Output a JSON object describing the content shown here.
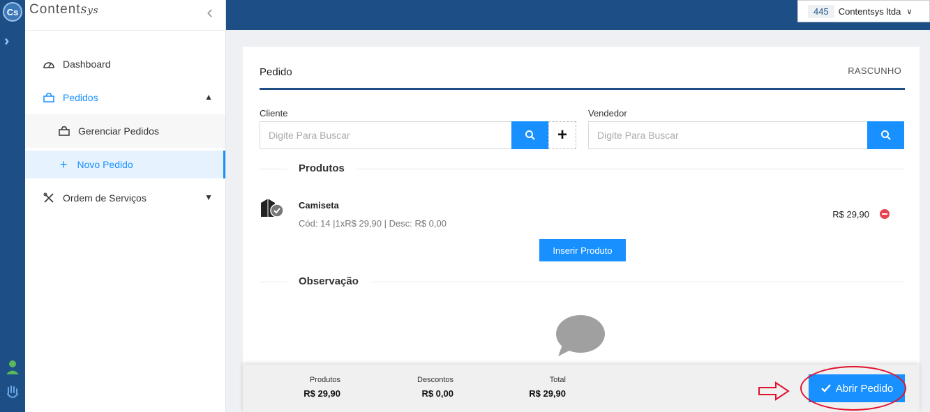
{
  "rail": {
    "logo_text": "Cs"
  },
  "brand": {
    "name_main": "Content",
    "name_sys": "Sys"
  },
  "sidebar": {
    "items": [
      {
        "label": "Dashboard"
      },
      {
        "label": "Pedidos"
      },
      {
        "label": "Gerenciar Pedidos"
      },
      {
        "label": "Novo Pedido"
      },
      {
        "label": "Ordem de Serviços"
      }
    ]
  },
  "company": {
    "code": "445",
    "name": "Contentsys ltda"
  },
  "order": {
    "title": "Pedido",
    "status": "RASCUNHO",
    "cliente_label": "Cliente",
    "cliente_placeholder": "Digite Para Buscar",
    "vendedor_label": "Vendedor",
    "vendedor_placeholder": "Digite Para Buscar",
    "produtos_section": "Produtos",
    "observacao_section": "Observação",
    "insert_button": "Inserir Produto"
  },
  "products": [
    {
      "name": "Camiseta",
      "details": "Cód: 14 |1xR$ 29,90 | Desc: R$ 0,00",
      "price": "R$ 29,90"
    }
  ],
  "totals": {
    "produtos_label": "Produtos",
    "produtos_value": "R$ 29,90",
    "descontos_label": "Descontos",
    "descontos_value": "R$ 0,00",
    "total_label": "Total",
    "total_value": "R$ 29,90"
  },
  "footer": {
    "open_button": "Abrir Pedido"
  },
  "colors": {
    "primary": "#1890ff",
    "navy": "#1d4f86",
    "danger": "#e8424f",
    "annotation": "#e0122f"
  }
}
